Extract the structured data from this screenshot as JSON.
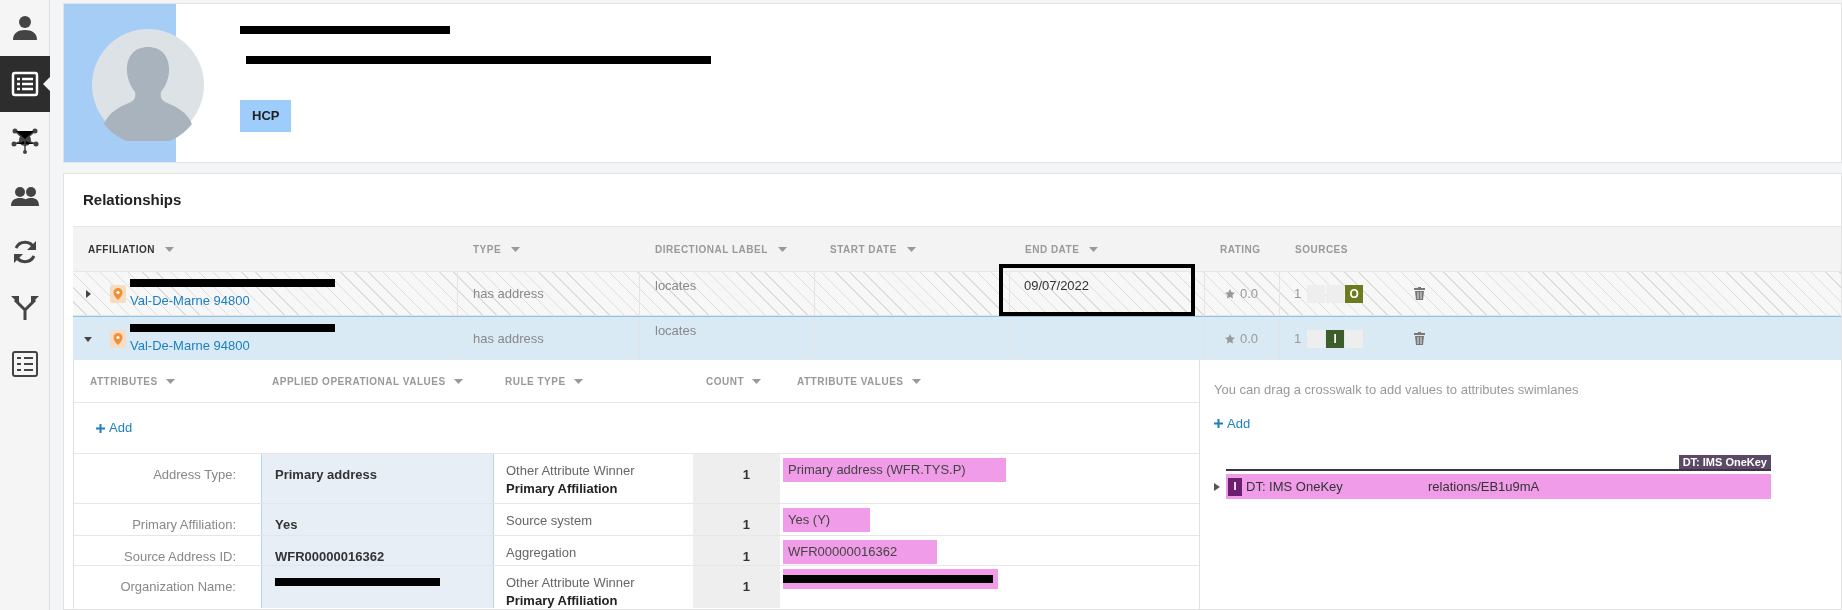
{
  "sidebar": {
    "items": [
      {
        "selected": false
      },
      {
        "selected": true
      },
      {
        "selected": false
      },
      {
        "selected": false
      },
      {
        "selected": false
      },
      {
        "selected": false
      },
      {
        "selected": false
      }
    ]
  },
  "profile": {
    "name_redacted": true,
    "address_redacted": true,
    "badge": "HCP"
  },
  "relationships": {
    "title": "Relationships",
    "columns": [
      {
        "label": "AFFILIATION",
        "sortable": true,
        "active": true
      },
      {
        "label": "TYPE",
        "sortable": true,
        "active": false
      },
      {
        "label": "DIRECTIONAL LABEL",
        "sortable": true,
        "active": false
      },
      {
        "label": "START DATE",
        "sortable": true,
        "active": false
      },
      {
        "label": "END DATE",
        "sortable": true,
        "active": false
      },
      {
        "label": "RATING",
        "sortable": false,
        "active": false
      },
      {
        "label": "SOURCES",
        "sortable": false,
        "active": false
      }
    ],
    "rows": [
      {
        "expanded": false,
        "selected": false,
        "inactive": true,
        "affiliation_line_1_redacted": true,
        "affiliation_line_2": "Val-De-Marne 94800",
        "type": "has address",
        "directional_label": "locates",
        "end_date": "09/07/2022",
        "end_date_outlined": true,
        "rating": "0.0",
        "sources_count": "1",
        "sources": [
          {
            "kind": "empty"
          },
          {
            "kind": "empty"
          },
          {
            "kind": "badge",
            "label": "O",
            "color": "#6b7b1e"
          }
        ]
      },
      {
        "expanded": true,
        "selected": true,
        "inactive": false,
        "affiliation_line_1_redacted": true,
        "affiliation_line_2": "Val-De-Marne 94800",
        "type": "has address",
        "directional_label": "locates",
        "rating": "0.0",
        "sources_count": "1",
        "sources": [
          {
            "kind": "empty"
          },
          {
            "kind": "badge",
            "label": "I",
            "color": "#3b5e2b"
          },
          {
            "kind": "empty"
          }
        ]
      }
    ],
    "details": {
      "columns": [
        "ATTRIBUTES",
        "APPLIED OPERATIONAL VALUES",
        "RULE TYPE",
        "COUNT",
        "ATTRIBUTE VALUES"
      ],
      "add_label": "Add",
      "rows": [
        {
          "attribute": "Address Type:",
          "applied_value": "Primary address",
          "rule_type": "Other Attribute Winner",
          "rule_detail": "Primary Affiliation",
          "count": "1",
          "attribute_value": "Primary address (WFR.TYS.P)"
        },
        {
          "attribute": "Primary Affiliation:",
          "applied_value": "Yes",
          "rule_type": "Source system",
          "count": "1",
          "attribute_value": "Yes (Y)"
        },
        {
          "attribute": "Source Address ID:",
          "applied_value": "WFR00000016362",
          "rule_type": "Aggregation",
          "count": "1",
          "attribute_value": "WFR00000016362"
        },
        {
          "attribute": "Organization Name:",
          "applied_value_redacted": true,
          "rule_type": "Other Attribute Winner",
          "rule_detail": "Primary Affiliation",
          "count": "1",
          "attribute_value_redacted": true
        }
      ]
    },
    "crosswalks": {
      "hint": "You can drag a crosswalk to add values to attributes swimlanes",
      "add_label": "Add",
      "group_tag": "DT: IMS OneKey",
      "items": [
        {
          "expanded": false,
          "badge": "I",
          "source": "DT: IMS OneKey",
          "uri": "relations/EB1u9mA"
        }
      ]
    }
  }
}
